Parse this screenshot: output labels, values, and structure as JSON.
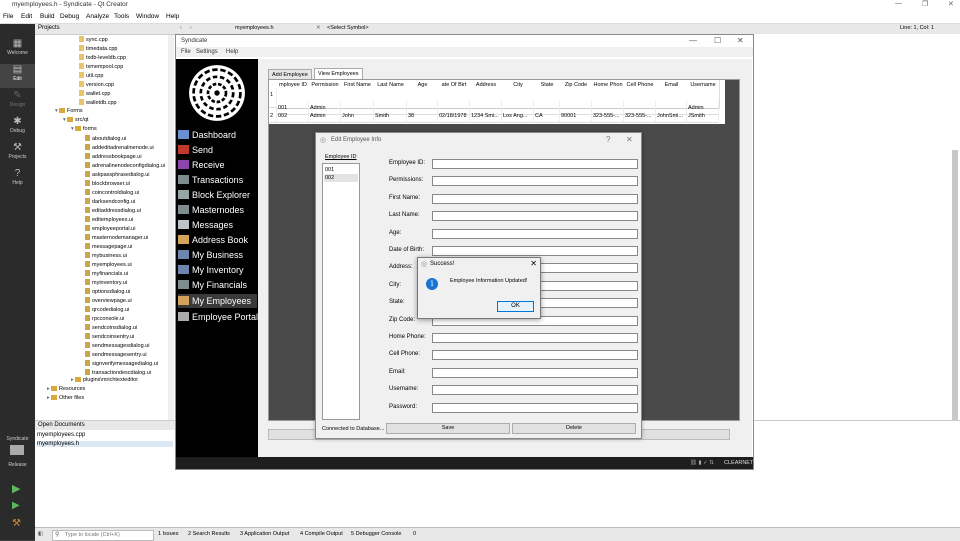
{
  "qt": {
    "title": "myemployees.h - Syndicate - Qt Creator",
    "menu": [
      "File",
      "Edit",
      "Build",
      "Debug",
      "Analyze",
      "Tools",
      "Window",
      "Help"
    ],
    "modes": [
      "Welcome",
      "Edit",
      "Design",
      "Debug",
      "Projects",
      "Help"
    ],
    "projects_header": "Projects",
    "tree_files_top": [
      "sync.cpp",
      "timedata.cpp",
      "txdb-leveldb.cpp",
      "txmempool.cpp",
      "util.cpp",
      "version.cpp",
      "wallet.cpp",
      "walletdb.cpp"
    ],
    "tree_forms": "Forms",
    "tree_srcqt": "src/qt",
    "tree_forms2": "forms",
    "tree_ui_files": [
      "aboutdialog.ui",
      "addeditadrenalinenode.ui",
      "addressbookpage.ui",
      "adrenalinenodeconfigdialog.ui",
      "askpassphrasedialog.ui",
      "blockbrowser.ui",
      "coincontroldialog.ui",
      "darksendconfig.ui",
      "editaddressdialog.ui",
      "editemployees.ui",
      "employeeportal.ui",
      "masternodemanager.ui",
      "messagepage.ui",
      "mybusiness.ui",
      "myemployees.ui",
      "myfinancials.ui",
      "myinventory.ui",
      "optionsdialog.ui",
      "overviewpage.ui",
      "qrcodedialog.ui",
      "rpcconsole.ui",
      "sendcoinsdialog.ui",
      "sendcoinsentry.ui",
      "sendmessagesdialog.ui",
      "sendmessagesentry.ui",
      "signverifymessagedialog.ui",
      "transactiondescdialog.ui"
    ],
    "tree_plugins": "plugins\\mrichtexteditor",
    "tree_resources": "Resources",
    "tree_other": "Other files",
    "open_docs_header": "Open Documents",
    "open_docs": [
      "myemployees.cpp",
      "myemployees.h"
    ],
    "editor_file": "myemployees.h",
    "editor_symbol": "<Select Symbol>",
    "editor_pos": "Line: 1, Col: 1",
    "kit_label": "Syndicate",
    "build_label": "Release",
    "locator_placeholder": "Type to locate (Ctrl+K)",
    "status_tabs": [
      "1  Issues",
      "2  Search Results",
      "3  Application Output",
      "4  Compile Output",
      "5  Debugger Console",
      "0"
    ]
  },
  "app": {
    "title": "Syndicate",
    "menu": [
      "File",
      "Settings",
      "Help"
    ],
    "nav": [
      "Dashboard",
      "Send",
      "Receive",
      "Transactions",
      "Block Explorer",
      "Masternodes",
      "Messages",
      "Address Book",
      "My Business",
      "My Inventory",
      "My Financials",
      "My Employees",
      "Employee Portal"
    ],
    "status_text": "CLEARNET",
    "tabs": [
      "Add Employee",
      "View Employees"
    ],
    "table": {
      "headers": [
        "mployee ID",
        "Permission",
        "First Name",
        "Last Name",
        "Age",
        "ate Of Birt",
        "Address",
        "City",
        "State",
        "Zip Code",
        "Home Phon",
        "Cell Phone",
        "Email",
        "Username"
      ],
      "row_numbers": [
        "1",
        "2"
      ],
      "rows": [
        [
          "001",
          "Admin",
          "",
          "",
          "",
          "",
          "",
          "",
          "",
          "",
          "",
          "",
          "",
          "Admin"
        ],
        [
          "002",
          "Admin",
          "John",
          "Smith",
          "38",
          "02/18/1978",
          "1234 Smi...",
          "Los Ang...",
          "CA",
          "90001",
          "323-555-...",
          "323-555-...",
          "JohnSmi...",
          "JSmith"
        ]
      ]
    }
  },
  "edit_dialog": {
    "title": "Edit Employee Info",
    "help": "?",
    "close": "✕",
    "list_label": "Employee ID",
    "list_items": [
      "001",
      "002"
    ],
    "fields": [
      "Employee ID:",
      "Permissions:",
      "First Name:",
      "Last Name:",
      "Age:",
      "Date of Birth:",
      "Address:",
      "City:",
      "State:",
      "Zip Code:",
      "Home Phone:",
      "Cell Phone:",
      "Email:",
      "Username:",
      "Password:"
    ],
    "connection": "Connected to Database...",
    "save": "Save",
    "delete": "Delete"
  },
  "msgbox": {
    "title": "Success!",
    "close": "✕",
    "message": "Employee Information Updated!",
    "ok": "OK"
  }
}
